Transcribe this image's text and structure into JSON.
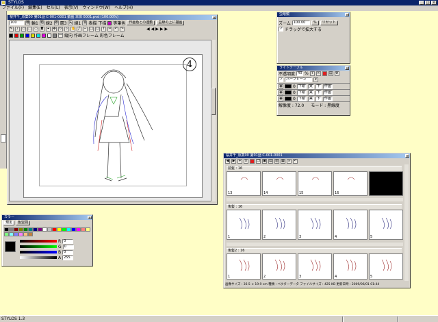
{
  "app": {
    "title": "STYLOS",
    "menu": [
      "ファイル(F)",
      "編集(E)",
      "セル(L)",
      "表示(V)",
      "ウィンドウ(W)",
      "ヘルプ(H)"
    ],
    "status_text": "STYLOS 1.3"
  },
  "canvas_window": {
    "title": "桜井千_原案00 第01話 C-001-0001 動画 本体 0001.pvd (100.00%)",
    "toolbar1": [
      "輪",
      "箱",
      "線",
      "矢",
      "消"
    ],
    "labels": {
      "zoom": "100",
      "layer1": "輪1",
      "layer2": "線2",
      "layer3": "層3",
      "line_option": "線1",
      "opt_a": "表描",
      "opt_b": "下描",
      "opt_c": "等筆色",
      "opt_d": "作画色との連動",
      "opt_e": "主線の上に描画",
      "frame_tab_a": "縦向",
      "frame_tab_b": "作画フレーム",
      "frame_tab_c": "彩色フレーム"
    },
    "page_number": "4"
  },
  "magnifier": {
    "title": "虫眼鏡",
    "zoom_label": "ズーム",
    "zoom_value": "100.00",
    "unit": "%",
    "reset_label": "リセット",
    "drag_zoom_label": "ドラッグで拡大する"
  },
  "light_table": {
    "title": "ライトテーブル",
    "opacity_label": "不透明度",
    "opacity_value": "40",
    "percent": "%",
    "mode_value": "ハーフトーン",
    "rows": [
      {
        "a": "0",
        "b": "下絵",
        "c": "実",
        "d": "下",
        "e": "作画"
      },
      {
        "a": "0",
        "b": "下絵",
        "c": "実",
        "d": "下",
        "e": "作画"
      },
      {
        "a": "0",
        "b": "下絵",
        "c": "実",
        "d": "下",
        "e": "作画"
      }
    ],
    "footer_a": "解像度 : 72.0",
    "footer_b": "モード : 黒線度"
  },
  "timeline": {
    "title": "桜井千_原案00 第01話 C-001-0001",
    "sections": [
      {
        "name": "前髪 : 16",
        "frames": [
          "13",
          "14",
          "15",
          "16",
          ""
        ]
      },
      {
        "name": "後髪 : 16",
        "frames": [
          "1",
          "2",
          "3",
          "4",
          "5"
        ]
      },
      {
        "name": "後髪2 : 16",
        "frames": [
          "1",
          "2",
          "3",
          "4",
          "5"
        ]
      }
    ],
    "status": "画像サイズ : 36.5 × 19.9 cm    種類 : ベクターデータ  ファイルサイズ : 425 KB    更新日時 : 2009/06/01 01:44"
  },
  "color_window": {
    "title": "カラー",
    "tab1": "規定",
    "tab2": "色空間",
    "channels": [
      {
        "name": "R",
        "value": "0"
      },
      {
        "name": "G",
        "value": "0"
      },
      {
        "name": "B",
        "value": "0"
      },
      {
        "name": "A",
        "value": "255"
      }
    ],
    "palette": [
      "#000000",
      "#808080",
      "#800000",
      "#808000",
      "#008000",
      "#008080",
      "#000080",
      "#800080",
      "#ffffff",
      "#c0c0c0",
      "#ff0000",
      "#ffff00",
      "#00ff00",
      "#00ffff",
      "#0000ff",
      "#ff00ff",
      "#ff8080",
      "#ffff80",
      "#80ff80",
      "#80ffff",
      "#8080ff",
      "#ff80ff",
      "#ffc080",
      "#c08040"
    ],
    "accent": "#0a246a"
  }
}
